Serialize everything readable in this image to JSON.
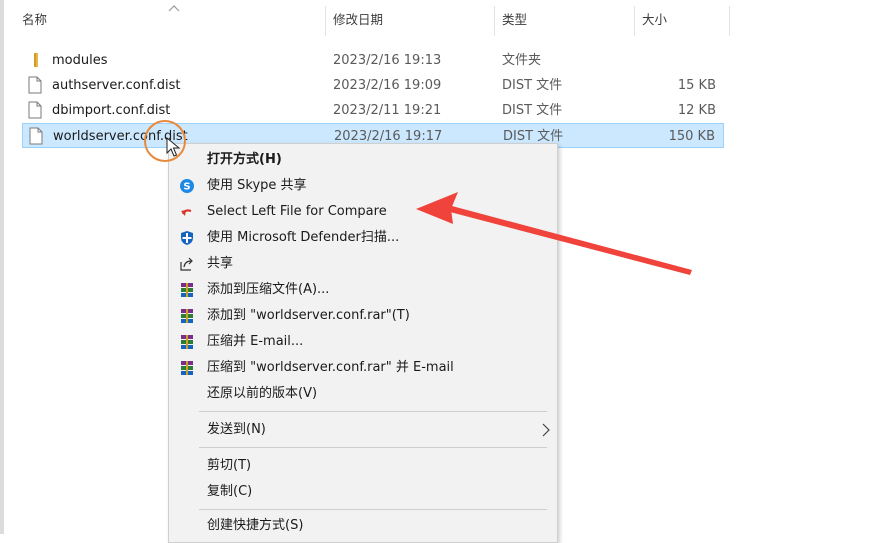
{
  "columns": {
    "name": "名称",
    "date": "修改日期",
    "type": "类型",
    "size": "大小"
  },
  "files": [
    {
      "name": "modules",
      "date": "2023/2/16 19:13",
      "type": "文件夹",
      "size": "",
      "kind": "folder"
    },
    {
      "name": "authserver.conf.dist",
      "date": "2023/2/16 19:09",
      "type": "DIST 文件",
      "size": "15 KB",
      "kind": "file"
    },
    {
      "name": "dbimport.conf.dist",
      "date": "2023/2/11 19:21",
      "type": "DIST 文件",
      "size": "12 KB",
      "kind": "file"
    },
    {
      "name": "worldserver.conf.dist",
      "date": "2023/2/16 19:17",
      "type": "DIST 文件",
      "size": "150 KB",
      "kind": "file",
      "selected": true
    }
  ],
  "context_menu": {
    "open_with": "打开方式(H)",
    "skype_share": "使用 Skype 共享",
    "compare": "Select Left File for Compare",
    "defender": "使用 Microsoft Defender扫描...",
    "share": "共享",
    "add_archive": "添加到压缩文件(A)...",
    "add_rar": "添加到 \"worldserver.conf.rar\"(T)",
    "compress_email": "压缩并 E-mail...",
    "compress_rar_email": "压缩到 \"worldserver.conf.rar\" 并 E-mail",
    "restore": "还原以前的版本(V)",
    "send_to": "发送到(N)",
    "cut": "剪切(T)",
    "copy": "复制(C)",
    "create_shortcut": "创建快捷方式(S)"
  },
  "colors": {
    "selection_bg": "#cce8ff",
    "menu_bg": "#f2f2f2",
    "annotation_arrow": "#f0433b",
    "annotation_ring": "#e8893a"
  }
}
